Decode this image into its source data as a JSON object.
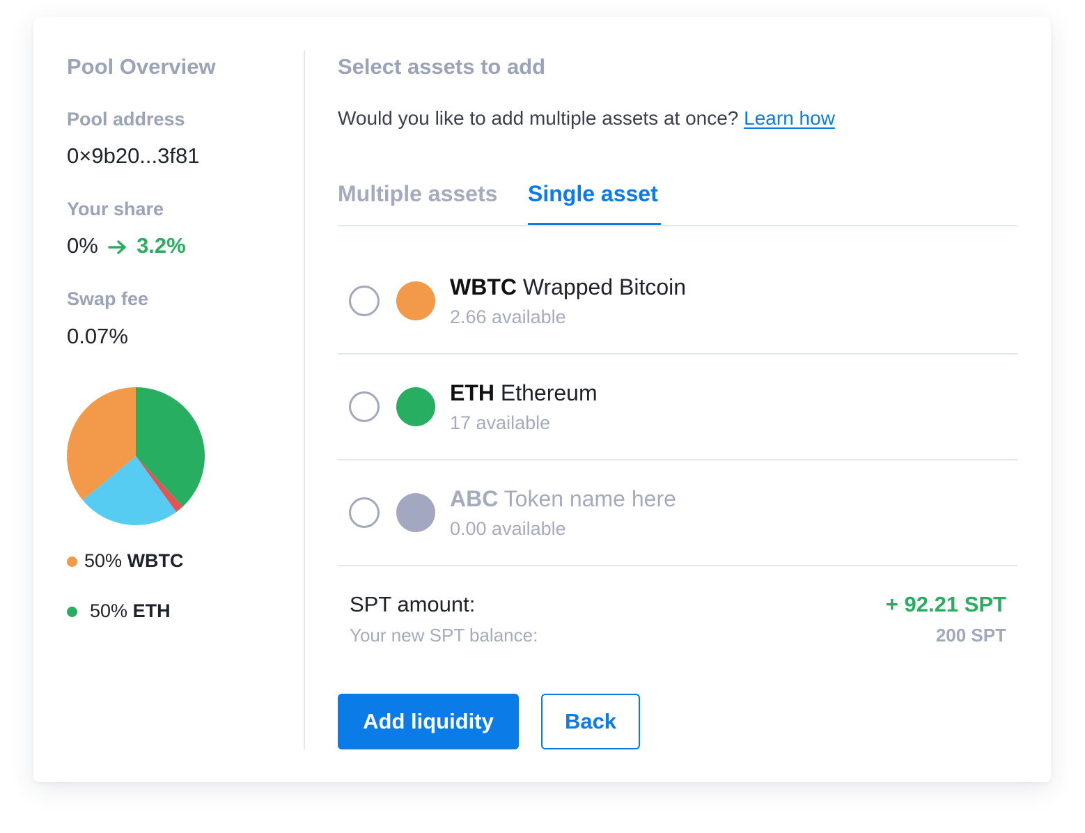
{
  "overview": {
    "title": "Pool Overview",
    "address_label": "Pool address",
    "address_value": "0×9b20...3f81",
    "share_label": "Your share",
    "share_from": "0%",
    "share_to": "3.2%",
    "fee_label": "Swap fee",
    "fee_value": "0.07%"
  },
  "chart_data": {
    "type": "pie",
    "slices": [
      {
        "color": "#27ae60",
        "value": 38
      },
      {
        "color": "#e05555",
        "value": 2
      },
      {
        "color": "#56ccf2",
        "value": 24
      },
      {
        "color": "#f2994a",
        "value": 36
      }
    ],
    "legend": [
      {
        "percent": "50%",
        "symbol": "WBTC",
        "color": "#f2994a"
      },
      {
        "percent": "50%",
        "symbol": "ETH",
        "color": "#27ae60"
      }
    ]
  },
  "select": {
    "title": "Select assets to add",
    "question": "Would you like to add multiple assets at once?",
    "learn_link": "Learn how"
  },
  "tabs": [
    {
      "label": "Multiple assets",
      "active": false
    },
    {
      "label": "Single asset",
      "active": true
    }
  ],
  "assets": [
    {
      "symbol": "WBTC",
      "name": "Wrapped Bitcoin",
      "available": "2.66 available",
      "color": "#f2994a",
      "disabled": false
    },
    {
      "symbol": "ETH",
      "name": "Ethereum",
      "available": "17 available",
      "color": "#27ae60",
      "disabled": false
    },
    {
      "symbol": "ABC",
      "name": "Token name here",
      "available": "0.00 available",
      "color": "#a2a8bf",
      "disabled": true
    }
  ],
  "summary": {
    "amount_label": "SPT amount:",
    "amount_value": "+ 92.21 SPT",
    "balance_label": "Your new SPT balance:",
    "balance_value": "200 SPT"
  },
  "buttons": {
    "add_label": "Add liquidity",
    "back_label": "Back"
  },
  "colors": {
    "accent": "#0a7be7",
    "positive": "#27ae60",
    "muted": "#9aa3b8"
  },
  "icons": {
    "share_arrow": "arrow-right-icon"
  }
}
